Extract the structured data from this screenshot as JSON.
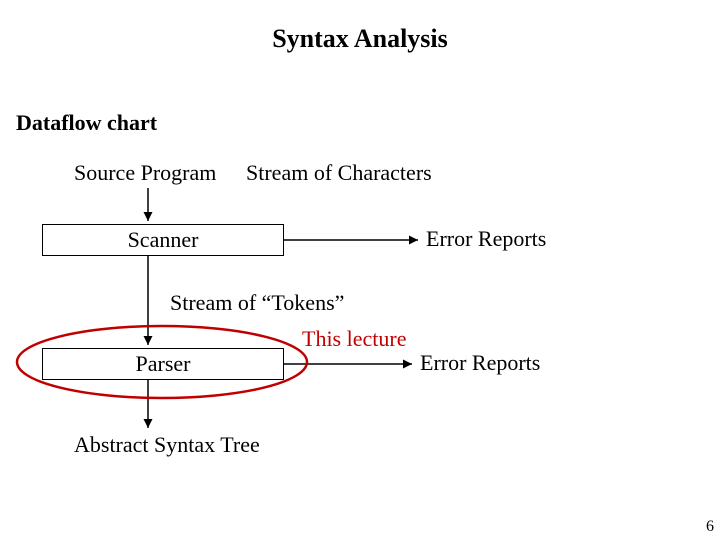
{
  "title": "Syntax Analysis",
  "subtitle": "Dataflow chart",
  "labels": {
    "source_program": "Source Program",
    "stream_chars": "Stream of Characters",
    "stream_tokens": "Stream of “Tokens”",
    "ast": "Abstract Syntax Tree",
    "error1": "Error Reports",
    "error2": "Error Reports"
  },
  "boxes": {
    "scanner": "Scanner",
    "parser": "Parser"
  },
  "annotation": "This lecture",
  "page_number": "6",
  "colors": {
    "annotation": "#c00000"
  }
}
